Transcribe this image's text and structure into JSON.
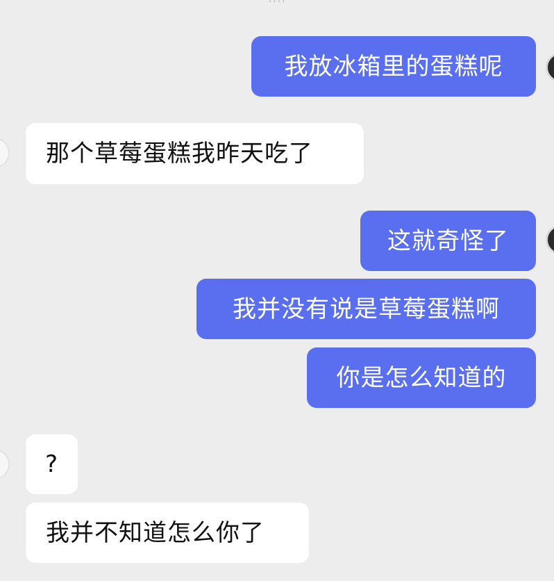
{
  "header": {
    "timestamp": "????"
  },
  "messages": [
    {
      "side": "sent",
      "text": "我放冰箱里的蛋糕呢"
    },
    {
      "side": "received",
      "text": "那个草莓蛋糕我昨天吃了"
    },
    {
      "side": "sent",
      "text": "这就奇怪了"
    },
    {
      "side": "sent",
      "text": "我并没有说是草莓蛋糕啊"
    },
    {
      "side": "sent",
      "text": "你是怎么知道的"
    },
    {
      "side": "received",
      "text": "?"
    },
    {
      "side": "received",
      "text": "我并不知道怎么你了"
    }
  ],
  "colors": {
    "background": "#ededed",
    "sent_bubble": "#5a6ff0",
    "received_bubble": "#ffffff"
  }
}
